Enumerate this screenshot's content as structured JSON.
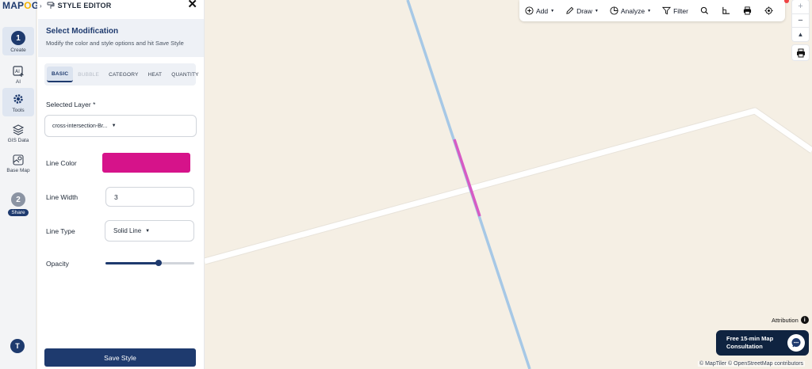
{
  "logo": {
    "prefix": "MAP",
    "accent": "O",
    "suffix": "G"
  },
  "rail": {
    "step1_number": "1",
    "step1_label": "Create",
    "ai_label": "AI",
    "tools_label": "Tools",
    "gis_label": "GIS Data",
    "basemap_label": "Base Map",
    "step2_number": "2",
    "step2_label": "Share",
    "avatar_initial": "T"
  },
  "panel": {
    "chevron": "›",
    "title": "STYLE EDITOR",
    "close": "✕",
    "section_title": "Select Modification",
    "section_subtitle": "Modify the color and style options and hit Save Style",
    "tabs": [
      "BASIC",
      "BUBBLE",
      "CATEGORY",
      "HEAT",
      "QUANTITY"
    ],
    "selected_layer_label": "Selected Layer *",
    "selected_layer_value": "cross-intersection-Br...",
    "line_color_label": "Line Color",
    "line_color_value": "#d6138a",
    "line_width_label": "Line Width",
    "line_width_value": "3",
    "line_type_label": "Line Type",
    "line_type_value": "Solid Line",
    "opacity_label": "Opacity",
    "opacity_value": 0.6,
    "save_label": "Save Style"
  },
  "toolbar": {
    "add_label": "Add",
    "draw_label": "Draw",
    "analyze_label": "Analyze",
    "filter_label": "Filter",
    "icons": [
      "search-icon",
      "measure-icon",
      "print-icon",
      "locate-icon"
    ]
  },
  "zoom": {
    "plus": "+",
    "minus": "−",
    "compass": "▲"
  },
  "map": {
    "attribution_label": "Attribution",
    "info": "i",
    "consult_line1": "Free 15-min Map",
    "consult_line2": "Consultation",
    "credits": "© MapTiler © OpenStreetMap contributors",
    "colors": {
      "road": "#ffffff",
      "river": "#a6c8e6",
      "highlight": "#d65bc4",
      "land": "#f5efe4"
    }
  }
}
